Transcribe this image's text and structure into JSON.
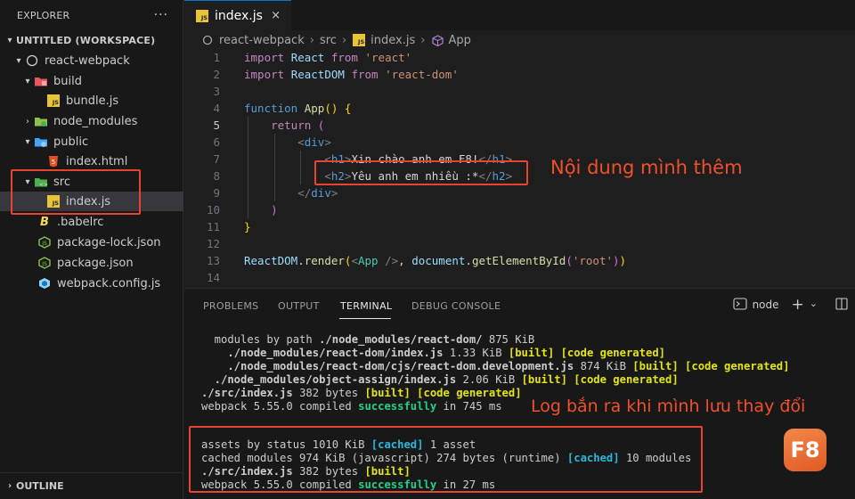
{
  "sidebar": {
    "title": "EXPLORER",
    "more": "···",
    "workspace": "UNTITLED (WORKSPACE)",
    "items": [
      {
        "label": "react-webpack"
      },
      {
        "label": "build"
      },
      {
        "label": "bundle.js"
      },
      {
        "label": "node_modules"
      },
      {
        "label": "public"
      },
      {
        "label": "index.html"
      },
      {
        "label": "src"
      },
      {
        "label": "index.js"
      },
      {
        "label": ".babelrc"
      },
      {
        "label": "package-lock.json"
      },
      {
        "label": "package.json"
      },
      {
        "label": "webpack.config.js"
      }
    ],
    "outline": "OUTLINE"
  },
  "editor": {
    "tab": {
      "label": "index.js",
      "close": "×"
    },
    "breadcrumb": [
      "react-webpack",
      "src",
      "index.js",
      "App"
    ],
    "line_numbers": [
      "1",
      "2",
      "3",
      "4",
      "5",
      "6",
      "7",
      "8",
      "9",
      "10",
      "11",
      "12",
      "13",
      "14"
    ]
  },
  "annotations": {
    "code_note": "Nội dung mình thêm",
    "log_note": "Log bắn ra khi mình lưu thay đổi"
  },
  "panel": {
    "tabs": [
      "PROBLEMS",
      "OUTPUT",
      "TERMINAL",
      "DEBUG CONSOLE"
    ],
    "active_tab": "TERMINAL",
    "terminal_name": "node",
    "plus": "+",
    "chevron": "⌄"
  },
  "terminal": {
    "l1a": "  modules by path ",
    "l1b": "./node_modules/react-dom/",
    "l1c": " 875 KiB",
    "l2a": "    ./node_modules/react-dom/index.js",
    "l2b": " 1.33 KiB ",
    "l3a": "    ./node_modules/react-dom/cjs/react-dom.development.js",
    "l3b": " 874 KiB ",
    "l4a": "  ./node_modules/object-assign/index.js",
    "l4b": " 2.06 KiB ",
    "l5a": "./src/index.js",
    "l5b": " 382 bytes ",
    "built": "[built]",
    "codegen": "[code generated]",
    "l6a": "webpack 5.55.0 compiled ",
    "successfully": "successfully",
    "l6c": " in 745 ms",
    "l7a": "assets by status 1010 KiB ",
    "cached": "[cached]",
    "l7c": " 1 asset",
    "l8a": "cached modules 974 KiB (javascript) 274 bytes (runtime) ",
    "l8c": " 10 modules",
    "l9a": "./src/index.js",
    "l9b": " 382 bytes ",
    "l10a": "webpack 5.55.0 compiled ",
    "l10c": " in 27 ms"
  },
  "logo": "F8",
  "colors": {
    "accent": "#0078d4",
    "annotation": "#e5442f",
    "success": "#23d18b",
    "built": "#e5e510"
  }
}
